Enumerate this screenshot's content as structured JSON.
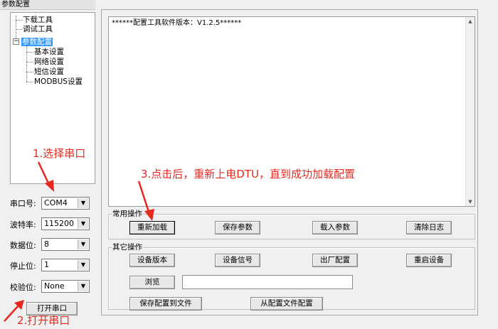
{
  "panel_title": "参数配置",
  "tree": {
    "items": [
      {
        "label": "下载工具"
      },
      {
        "label": "调试工具"
      },
      {
        "label": "参数配置"
      },
      {
        "label": "基本设置"
      },
      {
        "label": "网络设置"
      },
      {
        "label": "短信设置"
      },
      {
        "label": "MODBUS设置"
      }
    ],
    "expander": "−"
  },
  "serial": {
    "port_label": "串口号:",
    "port_value": "COM4",
    "baud_label": "波特率:",
    "baud_value": "115200",
    "databits_label": "数据位:",
    "databits_value": "8",
    "stopbits_label": "停止位:",
    "stopbits_value": "1",
    "parity_label": "校验位:",
    "parity_value": "None",
    "open_button": "打开串口"
  },
  "log": {
    "text": "******配置工具软件版本：V1.2.5******"
  },
  "common_ops": {
    "title": "常用操作",
    "reload": "重新加载",
    "save_params": "保存参数",
    "load_params": "载入参数",
    "clear_log": "清除日志"
  },
  "other_ops": {
    "title": "其它操作",
    "device_version": "设备版本",
    "device_signal": "设备信号",
    "factory_config": "出厂配置",
    "restart_device": "重启设备",
    "browse": "浏览",
    "file_path": "",
    "save_to_file": "保存配置到文件",
    "from_file": "从配置文件配置"
  },
  "annotations": {
    "step1": "1.选择串口",
    "step2": "2.打开串口",
    "step3": "3.点击后，重新上电DTU，直到成功加载配置",
    "color": "#e8281e"
  }
}
